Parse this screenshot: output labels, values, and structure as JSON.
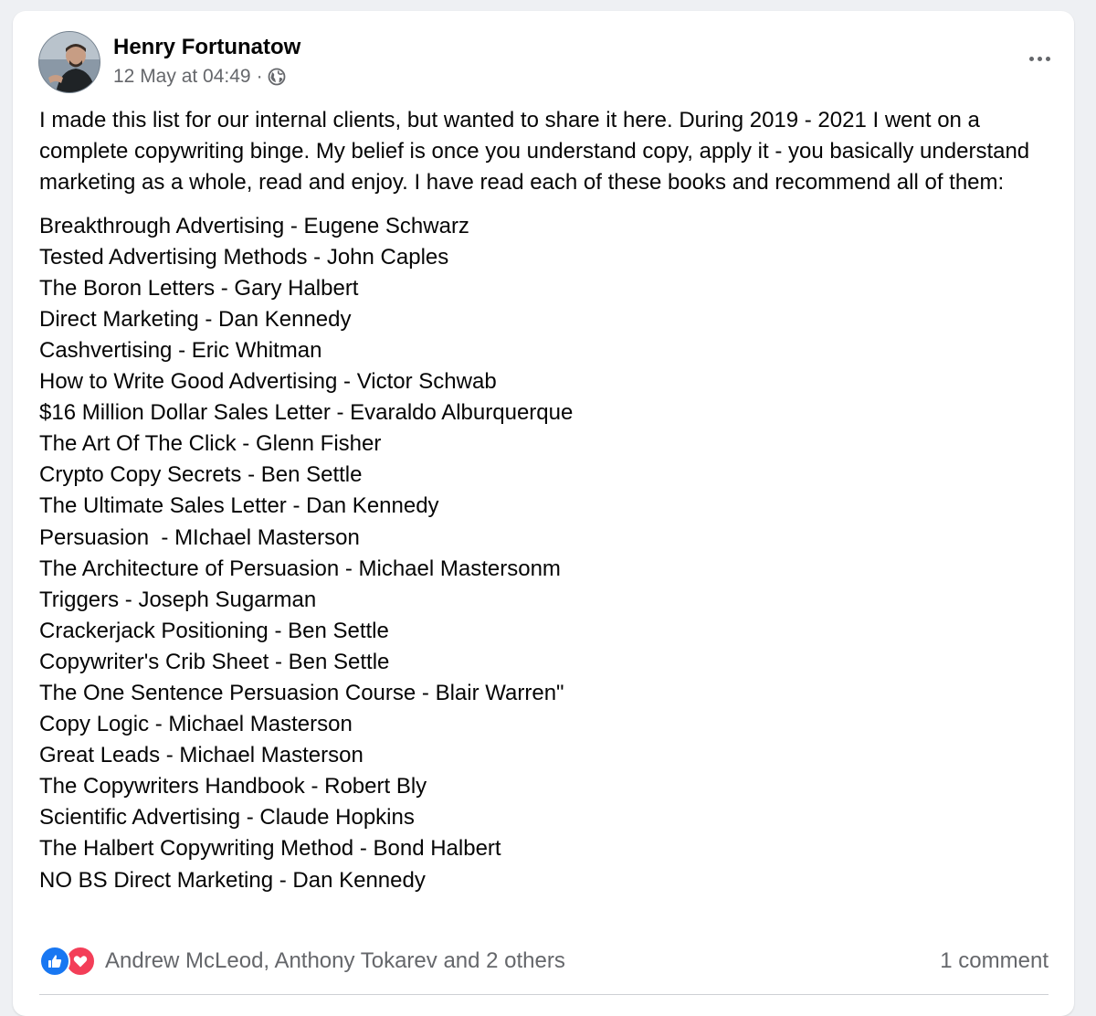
{
  "post": {
    "author": "Henry Fortunatow",
    "timestamp": "12 May at 04:49",
    "separator": "·",
    "audience_icon": "globe-icon",
    "menu_icon": "more-options-icon",
    "intro": "I made this list for our internal clients, but wanted to share it here. During 2019 - 2021 I went on a complete copywriting binge. My belief is once you understand copy, apply it - you basically understand marketing as a whole, read and enjoy. I have read each of these books and recommend all of them:",
    "books": [
      "Breakthrough Advertising - Eugene Schwarz",
      "Tested Advertising Methods - John Caples",
      "The Boron Letters - Gary Halbert",
      "Direct Marketing - Dan Kennedy",
      "Cashvertising - Eric Whitman",
      "How to Write Good Advertising - Victor Schwab",
      "$16 Million Dollar Sales Letter - Evaraldo Alburquerque",
      "The Art Of The Click - Glenn Fisher",
      "Crypto Copy Secrets - Ben Settle",
      "The Ultimate Sales Letter - Dan Kennedy",
      "Persuasion  - MIchael Masterson",
      "The Architecture of Persuasion - Michael Mastersonm",
      "Triggers - Joseph Sugarman",
      "Crackerjack Positioning - Ben Settle",
      "Copywriter's Crib Sheet - Ben Settle",
      "The One Sentence Persuasion Course - Blair Warren\"",
      "Copy Logic - Michael Masterson",
      "Great Leads - Michael Masterson",
      "The Copywriters Handbook - Robert Bly",
      "Scientific Advertising - Claude Hopkins",
      "The Halbert Copywriting Method - Bond Halbert",
      "NO BS Direct Marketing - Dan Kennedy"
    ]
  },
  "footer": {
    "reaction_icons": [
      "like-icon",
      "love-icon"
    ],
    "reactors": "Andrew McLeod, Anthony Tokarev and 2 others",
    "comments": "1 comment"
  },
  "colors": {
    "background": "#eef0f3",
    "card": "#ffffff",
    "primary_text": "#050505",
    "secondary_text": "#65676b",
    "like_blue": "#1877f2",
    "love_red": "#f33e58"
  }
}
